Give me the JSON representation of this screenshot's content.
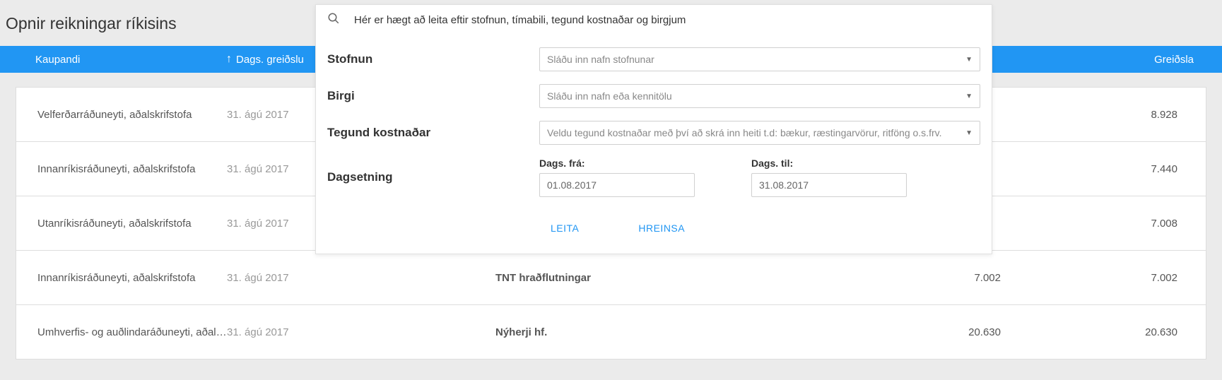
{
  "title": "Opnir reikningar ríkisins",
  "header": {
    "buyer": "Kaupandi",
    "date": "Dags. greiðslu",
    "payment": "Greiðsla"
  },
  "rows": [
    {
      "buyer": "Velferðarráðuneyti, aðalskrifstofa",
      "date": "31. ágú 2017",
      "supplier": "",
      "amount": "",
      "payment": "8.928"
    },
    {
      "buyer": "Innanríkisráðuneyti, aðalskrifstofa",
      "date": "31. ágú 2017",
      "supplier": "",
      "amount": "",
      "payment": "7.440"
    },
    {
      "buyer": "Utanríkisráðuneyti, aðalskrifstofa",
      "date": "31. ágú 2017",
      "supplier": "",
      "amount": "",
      "payment": "7.008"
    },
    {
      "buyer": "Innanríkisráðuneyti, aðalskrifstofa",
      "date": "31. ágú 2017",
      "supplier": "TNT hraðflutningar",
      "amount": "7.002",
      "payment": "7.002"
    },
    {
      "buyer": "Umhverfis- og auðlindaráðuneyti, aðalsk…",
      "date": "31. ágú 2017",
      "supplier": "Nýherji hf.",
      "amount": "20.630",
      "payment": "20.630"
    }
  ],
  "search": {
    "placeholder": "Hér er hægt að leita eftir stofnun, tímabili, tegund kostnaðar og birgjum",
    "labels": {
      "agency": "Stofnun",
      "supplier": "Birgi",
      "costType": "Tegund kostnaðar",
      "date": "Dagsetning"
    },
    "dropdowns": {
      "agency": "Sláðu inn nafn stofnunar",
      "supplier": "Sláðu inn nafn eða kennitölu",
      "costType": "Veldu tegund kostnaðar með því að skrá inn heiti t.d: bækur, ræstingarvörur, ritföng o.s.frv."
    },
    "dateFromLabel": "Dags. frá:",
    "dateToLabel": "Dags. til:",
    "dateFrom": "01.08.2017",
    "dateTo": "31.08.2017",
    "actions": {
      "search": "LEITA",
      "clear": "HREINSA"
    }
  }
}
